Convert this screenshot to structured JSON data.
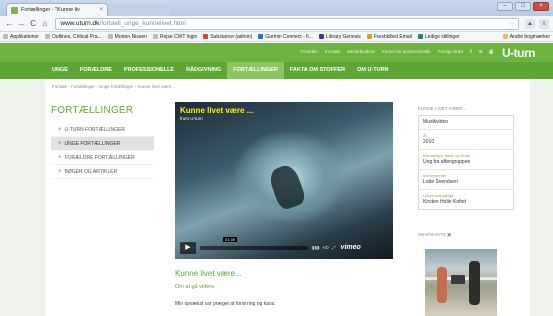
{
  "browser": {
    "tab_title": "Fortællinger - \"Kunne liv",
    "url_host": "www.uturn.dk",
    "url_path": "/fortaell_unge_kunnelivet.html",
    "bookmarks": [
      "Applikationer",
      "Outlines, Critical Pra...",
      "Morten Nissen",
      "Rejse CWT login",
      "Substance (admin)",
      "Garmin Connect - fi...",
      "Library Genesis",
      "Freshkilled Email",
      "Ledige stillinger"
    ],
    "other_bookmarks": "Andre bogmærker"
  },
  "site": {
    "logo": "U-turn",
    "top_links": [
      "Forsiden",
      "Kontakt",
      "Medarbejdere",
      "Kurser for professionelle",
      "Foreign links"
    ],
    "top_icons": [
      "f",
      "✉",
      "⎙"
    ],
    "nav": [
      "UNGE",
      "FORÆLDRE",
      "PROFESSIONELLE",
      "RÅDGIVNING",
      "FORTÆLLINGER",
      "FAKTA OM STOFFER",
      "OM U-TURN"
    ],
    "nav_active_index": 4,
    "breadcrumb": "Forside › Fortællinger › Unge fortællinger › Kunne livet være..."
  },
  "sidebar": {
    "title": "FORTÆLLINGER",
    "items": [
      {
        "label": "U-TURN FORTÆLLINGER"
      },
      {
        "label": "UNGE FORTÆLLINGER"
      },
      {
        "label": "FORÆLDRE FORTÆLLINGER"
      },
      {
        "label": "BØGER OG ARTIKLER"
      }
    ],
    "active_index": 1
  },
  "video": {
    "title": "Kunne livet være ...",
    "subtitle": "from U-turn",
    "time": "01:39",
    "hd": "HD",
    "brand": "vimeo"
  },
  "article": {
    "title": "Kunne livet være...",
    "subtitle": "Om at gå videre",
    "body": "Min opvækst var præget af forvirring og kaos."
  },
  "infobox": {
    "heading": "KUNNE LIVET VÆRE...",
    "rows": [
      {
        "label": "",
        "value": "Musikvideo"
      },
      {
        "label": "År",
        "value": "2010"
      },
      {
        "label": "Manuskript, tekst og musik",
        "value": "Ung fra aftengruppen"
      },
      {
        "label": "Medvirkende",
        "value": "Lotte Svendsen"
      },
      {
        "label": "U-turn ansvarlige",
        "value": "Kirsten Holte Kofod"
      }
    ]
  },
  "snapshots": {
    "heading": "SNAPSHOTS"
  }
}
